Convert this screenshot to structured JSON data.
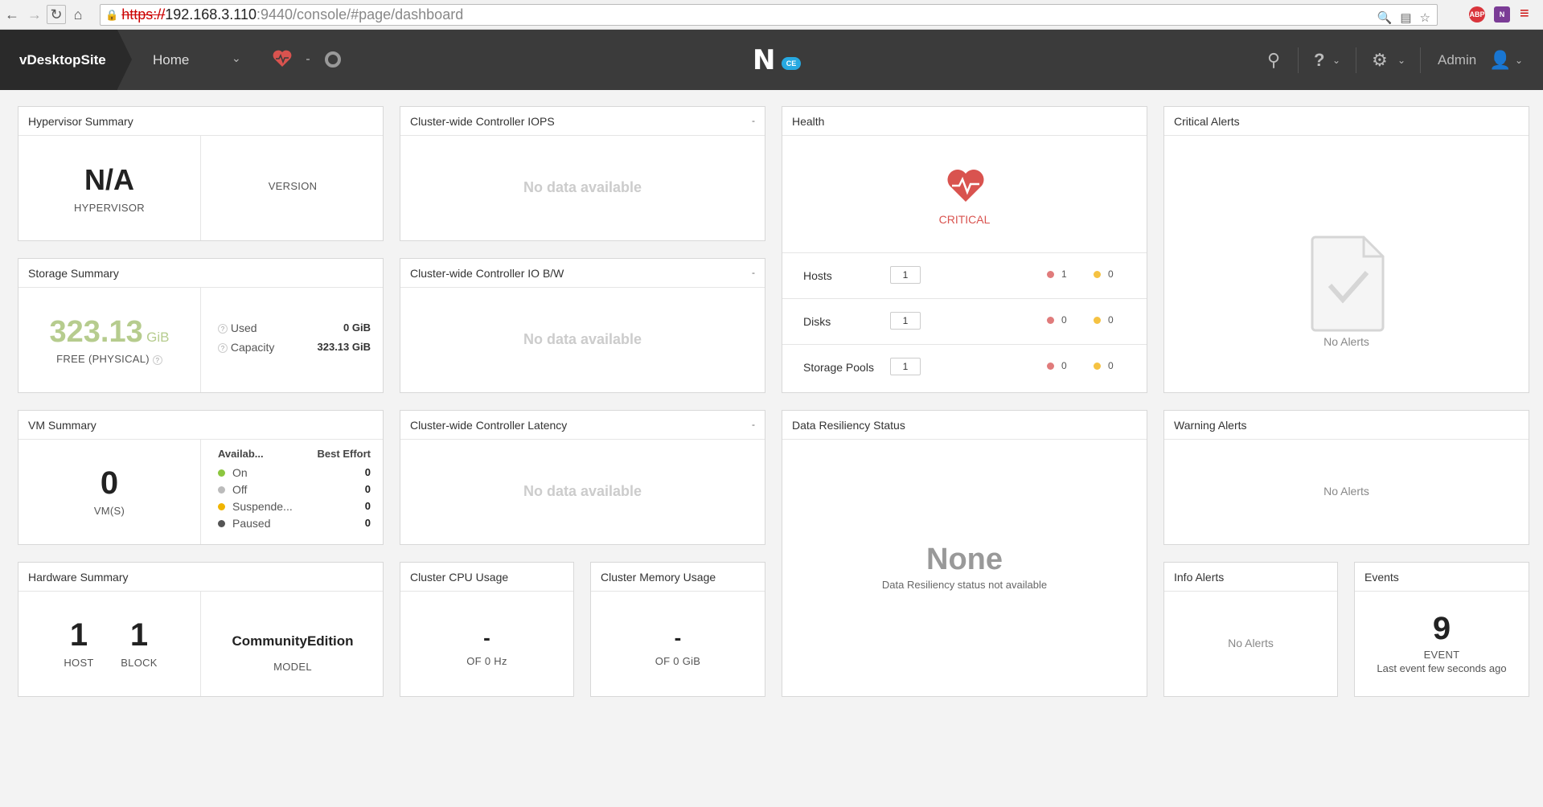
{
  "browser": {
    "url_proto": "https://",
    "url_host": "192.168.3.110",
    "url_path": ":9440/console/#page/dashboard",
    "ext_abp": "ABP",
    "ext_n": "N"
  },
  "header": {
    "site": "vDesktopSite",
    "home": "Home",
    "logo_letter": "N",
    "logo_badge": "CE",
    "help": "?",
    "user": "Admin",
    "accent": "#27a9e1",
    "health_color": "#d9534f"
  },
  "hypervisor": {
    "title": "Hypervisor Summary",
    "value": "N/A",
    "label": "HYPERVISOR",
    "version_label": "VERSION"
  },
  "storage": {
    "title": "Storage Summary",
    "free_value": "323.13",
    "free_unit": "GiB",
    "free_label": "FREE (PHYSICAL)",
    "used_label": "Used",
    "used_value": "0 GiB",
    "capacity_label": "Capacity",
    "capacity_value": "323.13 GiB"
  },
  "vm": {
    "title": "VM Summary",
    "count": "0",
    "label": "VM(S)",
    "col1": "Availab...",
    "col2": "Best Effort",
    "rows": [
      {
        "label": "On",
        "value": "0",
        "color": "#8cc63f"
      },
      {
        "label": "Off",
        "value": "0",
        "color": "#bbbbbb"
      },
      {
        "label": "Suspende...",
        "value": "0",
        "color": "#f0b400"
      },
      {
        "label": "Paused",
        "value": "0",
        "color": "#555555"
      }
    ]
  },
  "hardware": {
    "title": "Hardware Summary",
    "host_count": "1",
    "host_label": "HOST",
    "block_count": "1",
    "block_label": "BLOCK",
    "model_value": "CommunityEdition",
    "model_label": "MODEL"
  },
  "iops": {
    "title": "Cluster-wide Controller IOPS",
    "dash": "-",
    "empty": "No data available"
  },
  "iobw": {
    "title": "Cluster-wide Controller IO B/W",
    "dash": "-",
    "empty": "No data available"
  },
  "latency": {
    "title": "Cluster-wide Controller Latency",
    "dash": "-",
    "empty": "No data available"
  },
  "cpu": {
    "title": "Cluster CPU Usage",
    "value": "-",
    "sub": "OF 0 Hz"
  },
  "memory": {
    "title": "Cluster Memory Usage",
    "value": "-",
    "sub": "OF 0 GiB"
  },
  "health": {
    "title": "Health",
    "status": "CRITICAL",
    "rows": [
      {
        "label": "Hosts",
        "count": "1",
        "red": "1",
        "yellow": "0"
      },
      {
        "label": "Disks",
        "count": "1",
        "red": "0",
        "yellow": "0"
      },
      {
        "label": "Storage Pools",
        "count": "1",
        "red": "0",
        "yellow": "0"
      }
    ]
  },
  "resiliency": {
    "title": "Data Resiliency Status",
    "value": "None",
    "sub": "Data Resiliency status not available"
  },
  "critical_alerts": {
    "title": "Critical Alerts",
    "empty": "No Alerts"
  },
  "warning_alerts": {
    "title": "Warning Alerts",
    "empty": "No Alerts"
  },
  "info_alerts": {
    "title": "Info Alerts",
    "empty": "No Alerts"
  },
  "events": {
    "title": "Events",
    "count": "9",
    "label": "EVENT",
    "sub": "Last event few seconds ago"
  }
}
